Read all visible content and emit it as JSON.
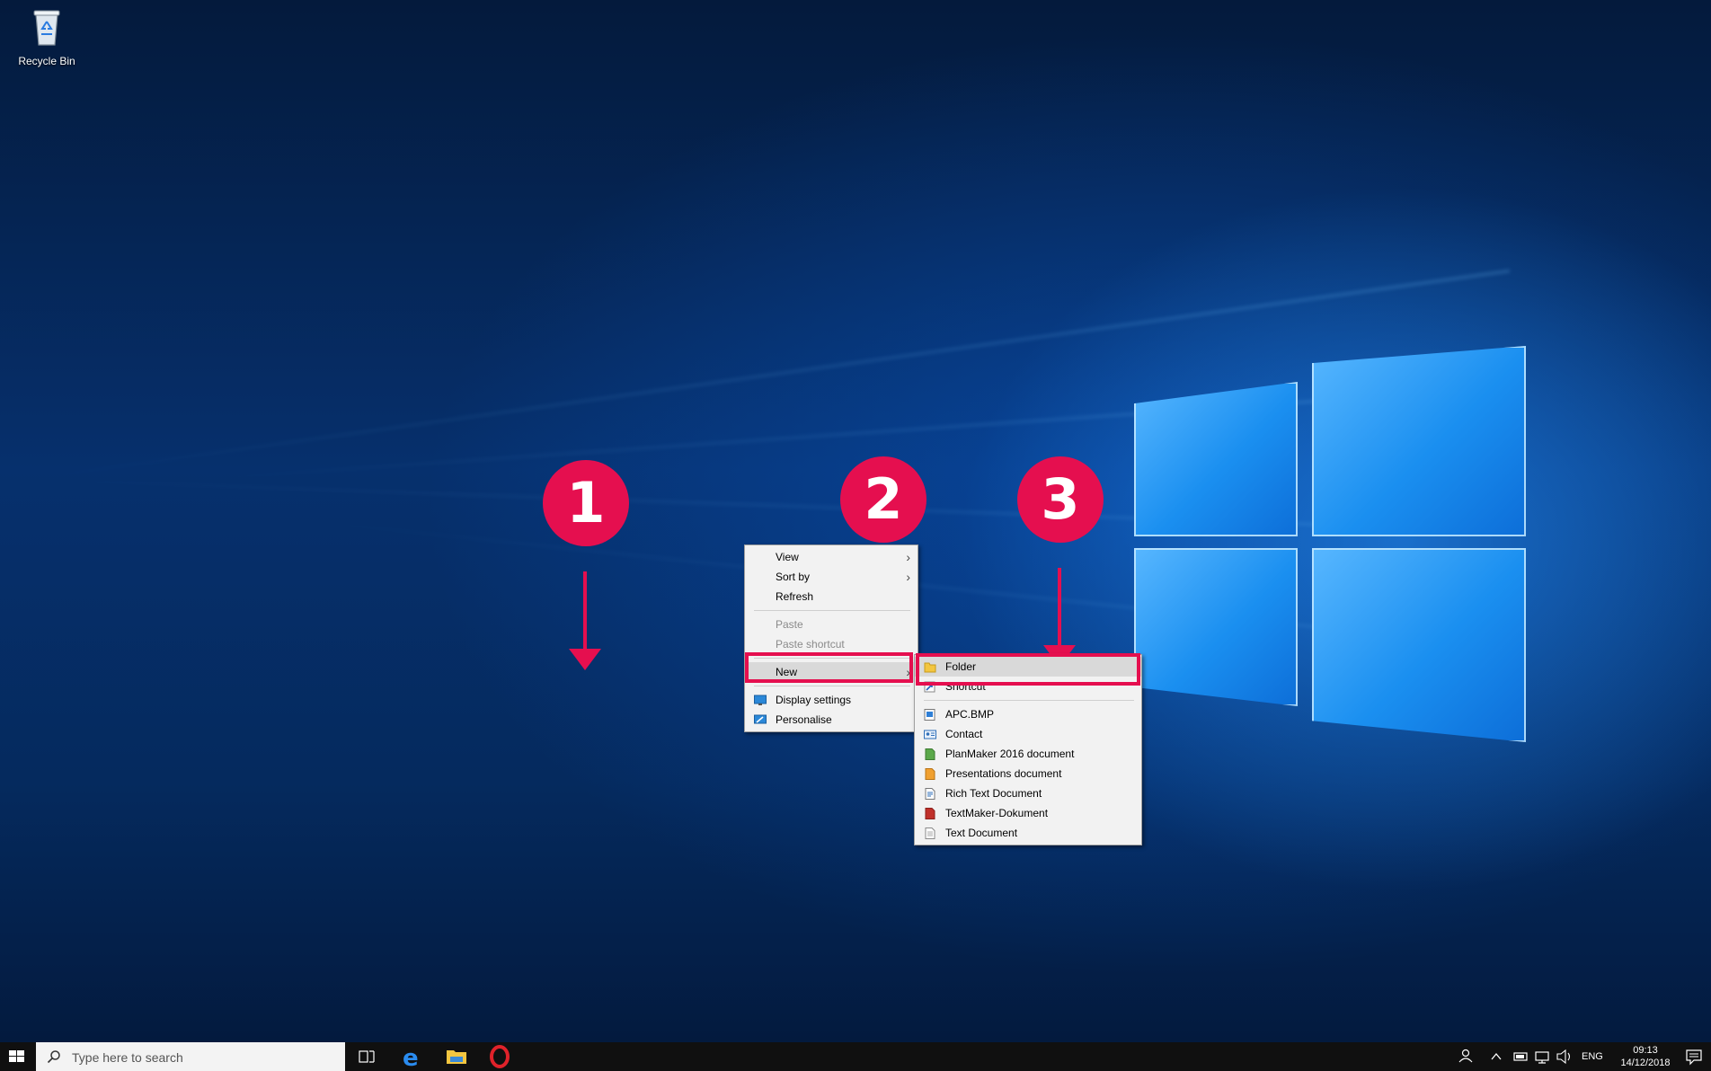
{
  "desktop": {
    "icons": [
      {
        "label": "Recycle Bin",
        "icon": "recycle-bin-icon"
      }
    ]
  },
  "context_menu": {
    "items": [
      {
        "label": "View",
        "submenu": true,
        "enabled": true
      },
      {
        "label": "Sort by",
        "submenu": true,
        "enabled": true
      },
      {
        "label": "Refresh",
        "enabled": true
      },
      {
        "label": "Paste",
        "enabled": false
      },
      {
        "label": "Paste shortcut",
        "enabled": false
      },
      {
        "label": "New",
        "submenu": true,
        "enabled": true,
        "highlighted": true
      },
      {
        "label": "Display settings",
        "icon": "display-icon",
        "enabled": true
      },
      {
        "label": "Personalise",
        "icon": "personalise-icon",
        "enabled": true
      }
    ]
  },
  "new_submenu": {
    "items": [
      {
        "label": "Folder",
        "icon": "folder-icon",
        "highlighted": true
      },
      {
        "label": "Shortcut",
        "icon": "shortcut-icon"
      },
      {
        "label": "APC.BMP",
        "icon": "bitmap-icon"
      },
      {
        "label": "Contact",
        "icon": "contact-icon"
      },
      {
        "label": "PlanMaker 2016 document",
        "icon": "planmaker-icon"
      },
      {
        "label": "Presentations document",
        "icon": "presentations-icon"
      },
      {
        "label": "Rich Text Document",
        "icon": "rich-text-icon"
      },
      {
        "label": "TextMaker-Dokument",
        "icon": "textmaker-icon"
      },
      {
        "label": "Text Document",
        "icon": "text-document-icon"
      }
    ]
  },
  "annotations": {
    "step1": "1",
    "step2": "2",
    "step3": "3",
    "color": "#e50f4f"
  },
  "taskbar": {
    "search_placeholder": "Type here to search",
    "apps": [
      "task-view-icon",
      "edge-icon",
      "file-explorer-icon",
      "opera-icon"
    ],
    "tray": {
      "language": "ENG",
      "time": "09:13",
      "date": "14/12/2018"
    }
  }
}
